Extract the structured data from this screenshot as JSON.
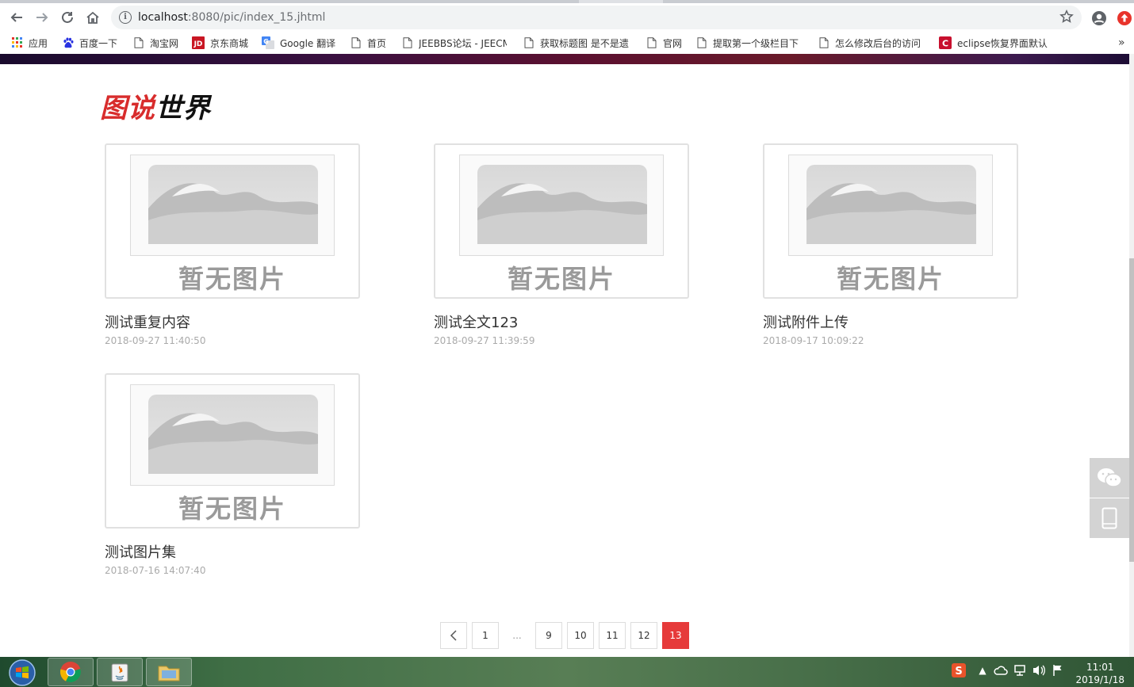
{
  "browser": {
    "url_host": "localhost",
    "url_path": ":8080/pic/index_15.jhtml"
  },
  "bookmarks": [
    {
      "label": "应用",
      "icon": "apps-grid-icon"
    },
    {
      "label": "百度一下",
      "icon": "baidu-paw-icon"
    },
    {
      "label": "淘宝网",
      "icon": "page-icon"
    },
    {
      "label": "京东商城",
      "icon": "jd-icon"
    },
    {
      "label": "Google 翻译",
      "icon": "google-translate-icon"
    },
    {
      "label": "首页",
      "icon": "page-icon"
    },
    {
      "label": "JEEBBS论坛 - JEECM",
      "icon": "page-icon"
    },
    {
      "label": "获取标题图 是不是遗",
      "icon": "page-icon"
    },
    {
      "label": "官网",
      "icon": "page-icon"
    },
    {
      "label": "提取第一个级栏目下",
      "icon": "page-icon"
    },
    {
      "label": "怎么修改后台的访问",
      "icon": "page-icon"
    },
    {
      "label": "eclipse恢复界面默认",
      "icon": "csdn-icon"
    }
  ],
  "page": {
    "logo_red": "图说",
    "logo_black": "世界",
    "placeholder_text": "暂无图片",
    "items": [
      {
        "title": "测试重复内容",
        "date": "2018-09-27 11:40:50"
      },
      {
        "title": "测试全文123",
        "date": "2018-09-27 11:39:59"
      },
      {
        "title": "测试附件上传",
        "date": "2018-09-17 10:09:22"
      },
      {
        "title": "测试图片集",
        "date": "2018-07-16 14:07:40"
      }
    ],
    "pagination": {
      "pages": [
        "1",
        "...",
        "9",
        "10",
        "11",
        "12",
        "13"
      ],
      "current": "13"
    }
  },
  "taskbar": {
    "time": "11:01",
    "date": "2019/1/18"
  },
  "colors": {
    "accent": "#e63a3a",
    "logo_red": "#d82c2c"
  }
}
